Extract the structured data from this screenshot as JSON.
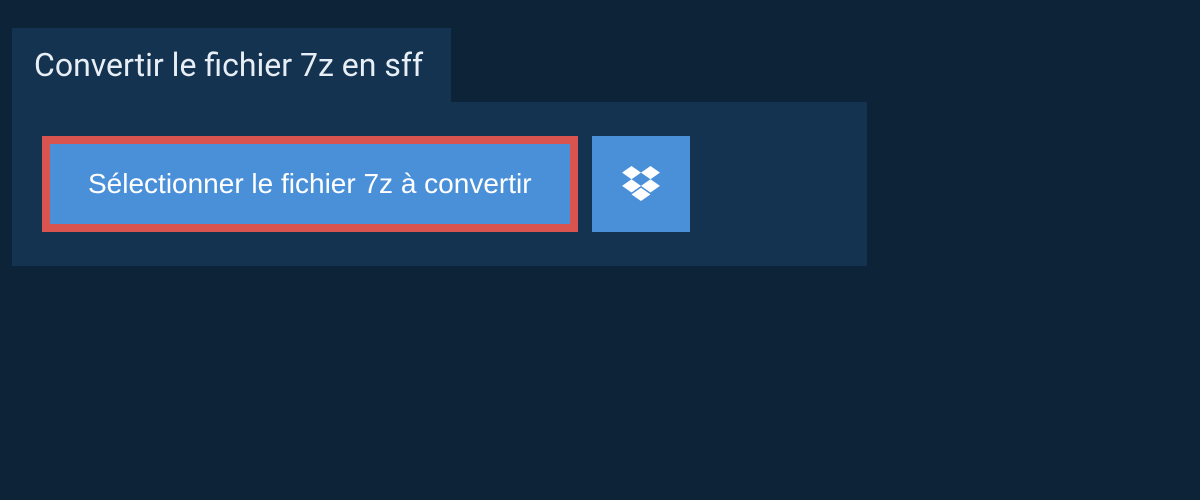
{
  "header": {
    "title": "Convertir le fichier 7z en sff"
  },
  "actions": {
    "select_file_label": "Sélectionner le fichier 7z à convertir"
  },
  "colors": {
    "background": "#0d2438",
    "panel": "#143350",
    "button": "#4a90d9",
    "highlight_border": "#d9534f"
  }
}
